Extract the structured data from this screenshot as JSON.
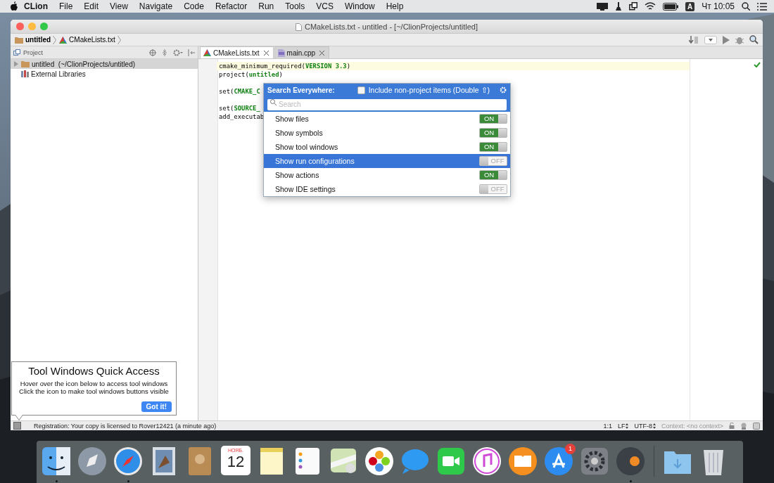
{
  "menu_bar": {
    "app": "CLion",
    "items": [
      "File",
      "Edit",
      "View",
      "Navigate",
      "Code",
      "Refactor",
      "Run",
      "Tools",
      "VCS",
      "Window",
      "Help"
    ],
    "input_source": "A",
    "clock": "Чт 10:05"
  },
  "window": {
    "title": "CMakeLists.txt - untitled - [~/ClionProjects/untitled]"
  },
  "breadcrumbs": [
    {
      "label": "untitled",
      "kind": "folder"
    },
    {
      "label": "CMakeLists.txt",
      "kind": "cmake"
    }
  ],
  "project_panel": {
    "title": "Project",
    "tree": [
      {
        "label": "untitled",
        "path": "(~/ClionProjects/untitled)",
        "kind": "folder",
        "expanded": false,
        "selected": true
      },
      {
        "label": "External Libraries",
        "kind": "library",
        "selected": false
      }
    ]
  },
  "editor": {
    "tabs": [
      {
        "label": "CMakeLists.txt",
        "kind": "cmake",
        "selected": true
      },
      {
        "label": "main.cpp",
        "kind": "cpp",
        "selected": false
      }
    ],
    "lines": [
      {
        "current": true,
        "segments": [
          {
            "t": "cmake_minimum_required("
          },
          {
            "t": "VERSION 3.3",
            "kind": "keyword"
          },
          {
            "t": ")"
          }
        ]
      },
      {
        "current": false,
        "segments": [
          {
            "t": "project("
          },
          {
            "t": "untitled",
            "kind": "keyword"
          },
          {
            "t": ")"
          }
        ]
      },
      {
        "current": false
      },
      {
        "current": false,
        "segments": [
          {
            "t": "set("
          },
          {
            "t": "CMAKE_C",
            "kind": "keyword"
          }
        ]
      },
      {
        "current": false
      },
      {
        "current": false,
        "segments": [
          {
            "t": "set("
          },
          {
            "t": "SOURCE_",
            "kind": "keyword"
          }
        ]
      },
      {
        "current": false,
        "segments": [
          {
            "t": "add_executab"
          }
        ]
      }
    ]
  },
  "search_everywhere": {
    "title": "Search Everywhere:",
    "include_label": "Include non-project items (Double ⇧)",
    "include_checked": false,
    "placeholder": "Search",
    "options": [
      {
        "label": "Show files",
        "on": true,
        "toggle": "ON",
        "selected": false
      },
      {
        "label": "Show symbols",
        "on": true,
        "toggle": "ON",
        "selected": false
      },
      {
        "label": "Show tool windows",
        "on": true,
        "toggle": "ON",
        "selected": false
      },
      {
        "label": "Show run configurations",
        "on": false,
        "toggle": "OFF",
        "selected": true
      },
      {
        "label": "Show actions",
        "on": true,
        "toggle": "ON",
        "selected": false
      },
      {
        "label": "Show IDE settings",
        "on": false,
        "toggle": "OFF",
        "selected": false
      }
    ]
  },
  "tooltip": {
    "title": "Tool Windows Quick Access",
    "lines": [
      "Hover over the icon below to access tool windows",
      "Click the icon to make tool windows buttons visible"
    ],
    "button": "Got it!"
  },
  "status_bar": {
    "message": "Registration: Your copy is licensed to Rover12421 (a minute ago)",
    "position": "1:1",
    "line_separator": "LF",
    "encoding": "UTF-8",
    "context": "Context: <no context>"
  },
  "dock": {
    "apps": [
      {
        "kind": "finder",
        "running": true
      },
      {
        "kind": "launchpad",
        "running": false
      },
      {
        "kind": "safari",
        "running": true
      },
      {
        "kind": "mail",
        "running": false
      },
      {
        "kind": "contacts",
        "running": false
      },
      {
        "kind": "calendar",
        "running": false,
        "month": "НОЯБ.",
        "day": "12"
      },
      {
        "kind": "notes",
        "running": false
      },
      {
        "kind": "reminders",
        "running": false
      },
      {
        "kind": "maps",
        "running": false
      },
      {
        "kind": "photos",
        "running": false
      },
      {
        "kind": "messages",
        "running": false
      },
      {
        "kind": "facetime",
        "running": false
      },
      {
        "kind": "music",
        "running": false
      },
      {
        "kind": "books",
        "running": false
      },
      {
        "kind": "appstore",
        "running": false,
        "badge": "1"
      },
      {
        "kind": "preferences",
        "running": false
      },
      {
        "kind": "clion",
        "running": true
      }
    ],
    "stacks": [
      {
        "kind": "downloads"
      },
      {
        "kind": "trash"
      }
    ]
  }
}
